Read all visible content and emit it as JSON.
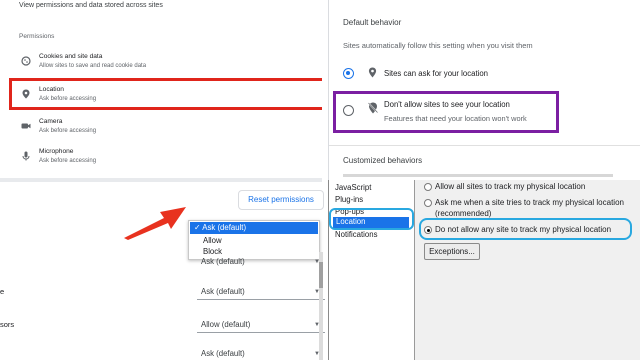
{
  "site_settings": {
    "header_text": "View permissions and data stored across sites",
    "section_label": "Permissions",
    "items": [
      {
        "icon": "cookie-icon",
        "title": "Cookies and site data",
        "subtitle": "Allow sites to save and read cookie data"
      },
      {
        "icon": "location-pin-icon",
        "title": "Location",
        "subtitle": "Ask before accessing"
      },
      {
        "icon": "camera-icon",
        "title": "Camera",
        "subtitle": "Ask before accessing"
      },
      {
        "icon": "microphone-icon",
        "title": "Microphone",
        "subtitle": "Ask before accessing"
      }
    ],
    "highlight_color": "#e0251b"
  },
  "default_behavior": {
    "heading": "Default behavior",
    "description": "Sites automatically follow this setting when you visit them",
    "options": [
      {
        "title": "Sites can ask for your location",
        "subtitle": "",
        "selected": true
      },
      {
        "title": "Don't allow sites to see your location",
        "subtitle": "Features that need your location won't work",
        "selected": false
      }
    ],
    "customized_heading": "Customized behaviors",
    "highlight_color": "#7b1fa2"
  },
  "content_settings": {
    "reset_label": "Reset permissions",
    "dropdown": {
      "selected": "Ask (default)",
      "options": [
        "Allow",
        "Block"
      ]
    },
    "rows": [
      {
        "label": "",
        "value": "Ask (default)"
      },
      {
        "label": "",
        "value": "Ask (default)"
      },
      {
        "label": "sors",
        "value": "Allow (default)"
      },
      {
        "label": "",
        "value": "Ask (default)"
      }
    ],
    "left_fragment": "e",
    "arrow_color": "#e8321f"
  },
  "privacy_options": {
    "list": [
      "JavaScript",
      "Plug-ins",
      "Pop-ups",
      "Location",
      "Notifications"
    ],
    "selected_list_item": "Location",
    "options": [
      {
        "text": "Allow all sites to track my physical location",
        "selected": false
      },
      {
        "text": "Ask me when a site tries to track my physical location",
        "text2": "(recommended)",
        "selected": false
      },
      {
        "text": "Do not allow any site to track my physical location",
        "selected": true
      }
    ],
    "exceptions_label": "Exceptions...",
    "highlight_color": "#29a8e0"
  }
}
